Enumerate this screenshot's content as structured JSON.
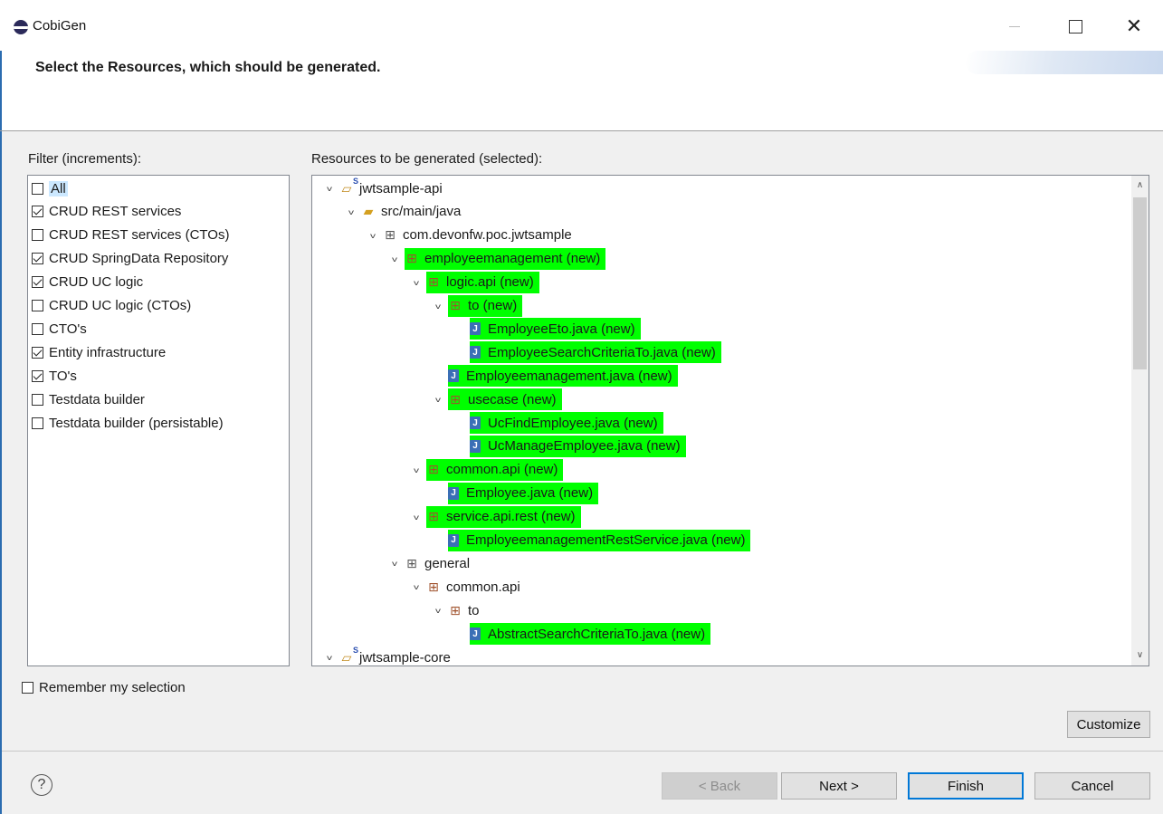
{
  "window": {
    "title": "CobiGen",
    "header": "Select the Resources, which should be generated."
  },
  "filter": {
    "label": "Filter (increments):",
    "items": [
      {
        "label": "All",
        "checked": false
      },
      {
        "label": "CRUD REST services",
        "checked": true
      },
      {
        "label": "CRUD REST services (CTOs)",
        "checked": false
      },
      {
        "label": "CRUD SpringData Repository",
        "checked": true
      },
      {
        "label": "CRUD UC logic",
        "checked": true
      },
      {
        "label": "CRUD UC logic (CTOs)",
        "checked": false
      },
      {
        "label": "CTO's",
        "checked": false
      },
      {
        "label": "Entity infrastructure",
        "checked": true
      },
      {
        "label": "TO's",
        "checked": true
      },
      {
        "label": "Testdata builder",
        "checked": false
      },
      {
        "label": "Testdata builder (persistable)",
        "checked": false
      }
    ]
  },
  "resources": {
    "label": "Resources to be generated (selected):",
    "tree": [
      {
        "label": "jwtsample-api",
        "icon": "project-icon"
      },
      {
        "label": "src/main/java",
        "icon": "source-folder-icon"
      },
      {
        "label": "com.devonfw.poc.jwtsample",
        "icon": "package-icon"
      },
      {
        "label": "employeemanagement (new)",
        "icon": "package-icon"
      },
      {
        "label": "logic.api (new)",
        "icon": "package-icon"
      },
      {
        "label": "to (new)",
        "icon": "package-icon"
      },
      {
        "label": "EmployeeEto.java (new)",
        "icon": "java-file-icon"
      },
      {
        "label": "EmployeeSearchCriteriaTo.java (new)",
        "icon": "java-file-icon"
      },
      {
        "label": "Employeemanagement.java (new)",
        "icon": "java-file-icon"
      },
      {
        "label": "usecase (new)",
        "icon": "package-icon"
      },
      {
        "label": "UcFindEmployee.java (new)",
        "icon": "java-file-icon"
      },
      {
        "label": "UcManageEmployee.java (new)",
        "icon": "java-file-icon"
      },
      {
        "label": "common.api (new)",
        "icon": "package-icon"
      },
      {
        "label": "Employee.java (new)",
        "icon": "java-file-icon"
      },
      {
        "label": "service.api.rest (new)",
        "icon": "package-icon"
      },
      {
        "label": "EmployeemanagementRestService.java (new)",
        "icon": "java-file-icon"
      },
      {
        "label": "general",
        "icon": "package-icon"
      },
      {
        "label": "common.api",
        "icon": "package-icon"
      },
      {
        "label": "to",
        "icon": "package-icon"
      },
      {
        "label": "AbstractSearchCriteriaTo.java (new)",
        "icon": "java-file-icon"
      },
      {
        "label": "jwtsample-core",
        "icon": "project-icon"
      }
    ]
  },
  "remember": {
    "label": "Remember my selection",
    "checked": false
  },
  "buttons": {
    "customize": "Customize",
    "back": "< Back",
    "next": "Next >",
    "finish": "Finish",
    "cancel": "Cancel",
    "help": "?"
  },
  "colors": {
    "highlight": "#00ff00",
    "accent": "#0078d7"
  }
}
